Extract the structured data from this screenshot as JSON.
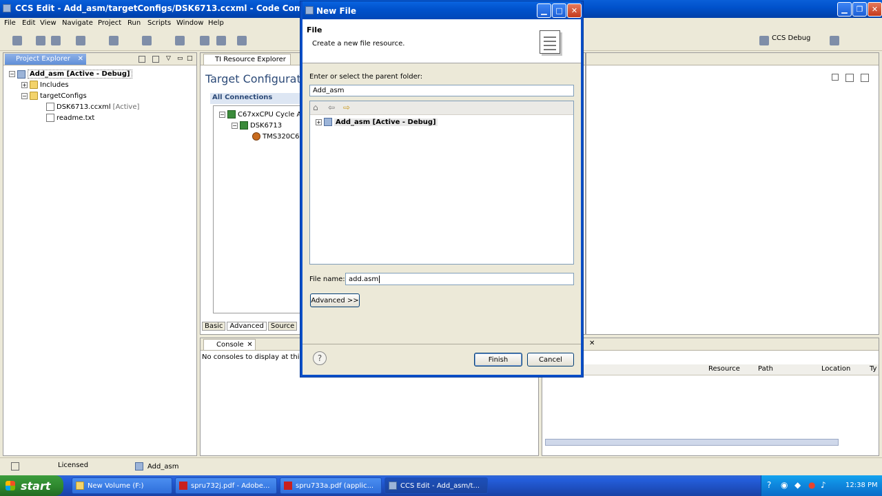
{
  "window": {
    "title": "CCS Edit - Add_asm/targetConfigs/DSK6713.ccxml - Code Composer Studio"
  },
  "menu": [
    "File",
    "Edit",
    "View",
    "Navigate",
    "Project",
    "Run",
    "Scripts",
    "Window",
    "Help"
  ],
  "toolbar": {
    "perspective_label": "CCS Debug"
  },
  "project_explorer": {
    "tab_label": "Project Explorer",
    "items": [
      {
        "label": "Add_asm [Active - Debug]",
        "bold": true
      },
      {
        "label": "Includes"
      },
      {
        "label": "targetConfigs"
      },
      {
        "label": "DSK6713.ccxml",
        "suffix": "[Active]"
      },
      {
        "label": "readme.txt"
      }
    ]
  },
  "editor": {
    "tab_label": "TI Resource Explorer",
    "heading": "Target Configurat",
    "section": "All Connections",
    "tree": [
      "C67xxCPU Cycle A",
      "DSK6713",
      "TMS320C6"
    ],
    "bottom_tabs": [
      "Basic",
      "Advanced",
      "Source"
    ]
  },
  "console": {
    "tab_label": "Console",
    "message": "No consoles to display at this tim"
  },
  "problems": {
    "columns": [
      "Resource",
      "Path",
      "Location",
      "Ty"
    ]
  },
  "status_bar": {
    "licensed": "Licensed",
    "project": "Add_asm"
  },
  "dialog": {
    "title": "New File",
    "header_title": "File",
    "header_desc": "Create a new file resource.",
    "parent_folder_label": "Enter or select the parent folder:",
    "parent_folder_value": "Add_asm",
    "tree_item": "Add_asm  [Active - Debug]",
    "file_name_label": "File name:",
    "file_name_value": "add.asm",
    "advanced_button": "Advanced >>",
    "finish_button": "Finish",
    "cancel_button": "Cancel"
  },
  "taskbar": {
    "start": "start",
    "items": [
      "New Volume (F:)",
      "spru732j.pdf - Adobe...",
      "spru733a.pdf (applic...",
      "CCS Edit - Add_asm/t..."
    ],
    "clock": "12:38 PM"
  }
}
